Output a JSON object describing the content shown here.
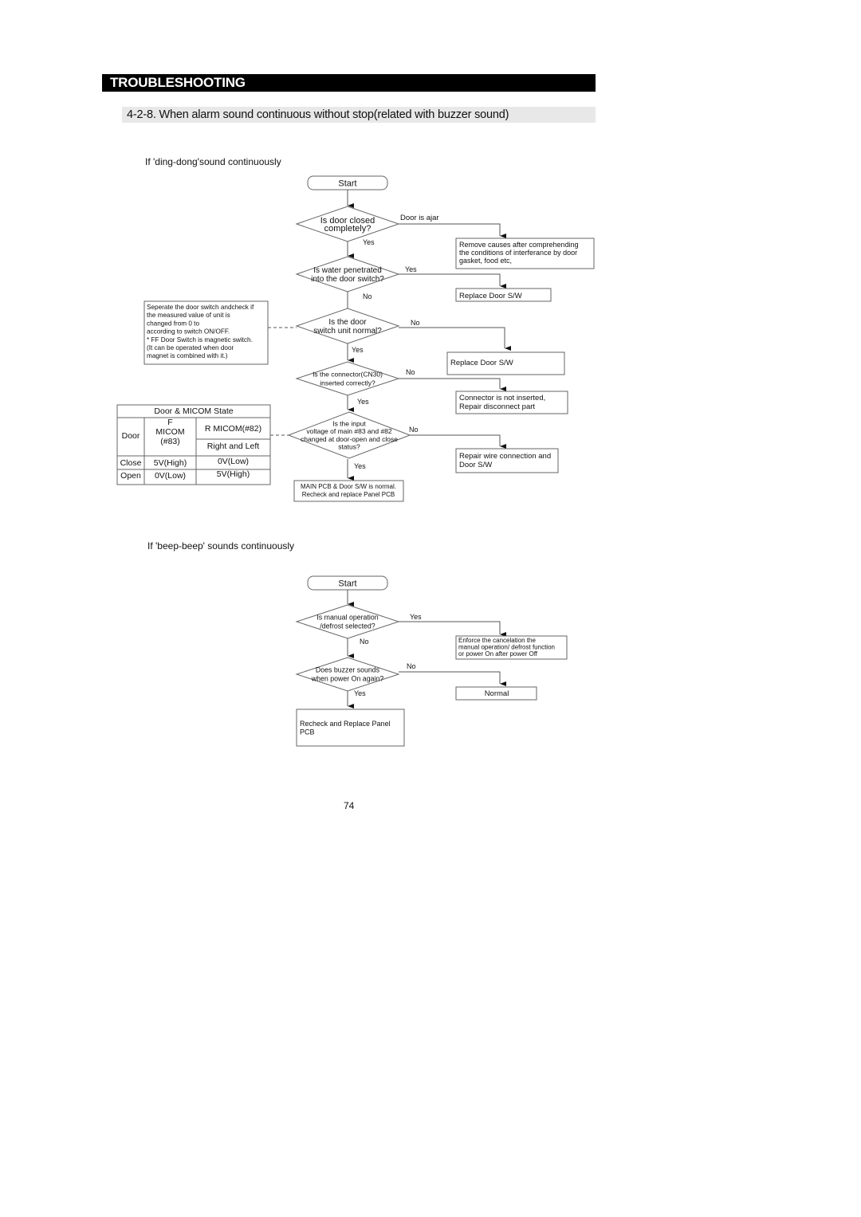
{
  "header": {
    "title": "TROUBLESHOOTING"
  },
  "section": {
    "title": "4-2-8. When alarm sound continuous without stop(related with buzzer sound)"
  },
  "flow1": {
    "heading": "If 'ding-dong'sound continuously",
    "start": "Start",
    "d1": {
      "lines": [
        "Is door closed",
        "completely?"
      ],
      "branch_label": "Door is ajar",
      "down_label": "Yes",
      "action": [
        "Remove causes after comprehending",
        "the conditions of interferance by door",
        "gasket, food etc,"
      ]
    },
    "d2": {
      "lines": [
        "Is water penetrated",
        "into the door switch?"
      ],
      "branch_label": "Yes",
      "down_label": "No",
      "action": [
        "Replace Door S/W"
      ]
    },
    "d3": {
      "lines": [
        "Is the door",
        "switch unit normal?"
      ],
      "branch_label": "No",
      "down_label": "Yes",
      "action": [
        "Replace Door S/W"
      ]
    },
    "d4": {
      "lines": [
        "Is the connector(CN30)",
        "inserted correctly?"
      ],
      "branch_label": "No",
      "down_label": "Yes",
      "action": [
        "Connector is not inserted,",
        "Repair disconnect part"
      ]
    },
    "d5": {
      "lines": [
        "Is the input",
        "voltage of main #83 and #82",
        "changed at door-open and close",
        "status?"
      ],
      "branch_label": "No",
      "down_label": "Yes",
      "action": [
        "Repair wire connection and",
        "Door S/W"
      ]
    },
    "end": [
      "MAIN PCB & Door S/W is normal.",
      "Recheck and replace Panel PCB"
    ],
    "note": [
      "Seperate the door switch andcheck if",
      "the measured value of unit is",
      "changed from 0     to",
      "according to switch ON/OFF.",
      "* FF Door Switch is magnetic switch.",
      "(It can be operated when door",
      " magnet is combined with it.)"
    ],
    "state_table": {
      "title": "Door & MICOM State",
      "col_door": "Door",
      "col_f": [
        "F",
        "MICOM",
        "(#83)"
      ],
      "col_r_top": "R MICOM(#82)",
      "col_r_bottom": "Right and Left",
      "rows": [
        {
          "door": "Close",
          "f": "5V(High)",
          "r": "0V(Low)"
        },
        {
          "door": "Open",
          "f": "0V(Low)",
          "r": "5V(High)"
        }
      ]
    }
  },
  "flow2": {
    "heading": "If 'beep-beep' sounds continuously",
    "start": "Start",
    "d1": {
      "lines": [
        "Is manual operation",
        "/defrost selected?"
      ],
      "branch_label": "Yes",
      "down_label": "No",
      "action": [
        "Enforce the cancelation the",
        "manual operation/ defrost function",
        "or power On after power Off"
      ]
    },
    "d2": {
      "lines": [
        "Does buzzer sounds",
        "when power On again?"
      ],
      "branch_label": "No",
      "down_label": "Yes",
      "action": [
        "Normal"
      ]
    },
    "end": [
      "Recheck and Replace Panel",
      "PCB"
    ]
  },
  "page_number": "74"
}
